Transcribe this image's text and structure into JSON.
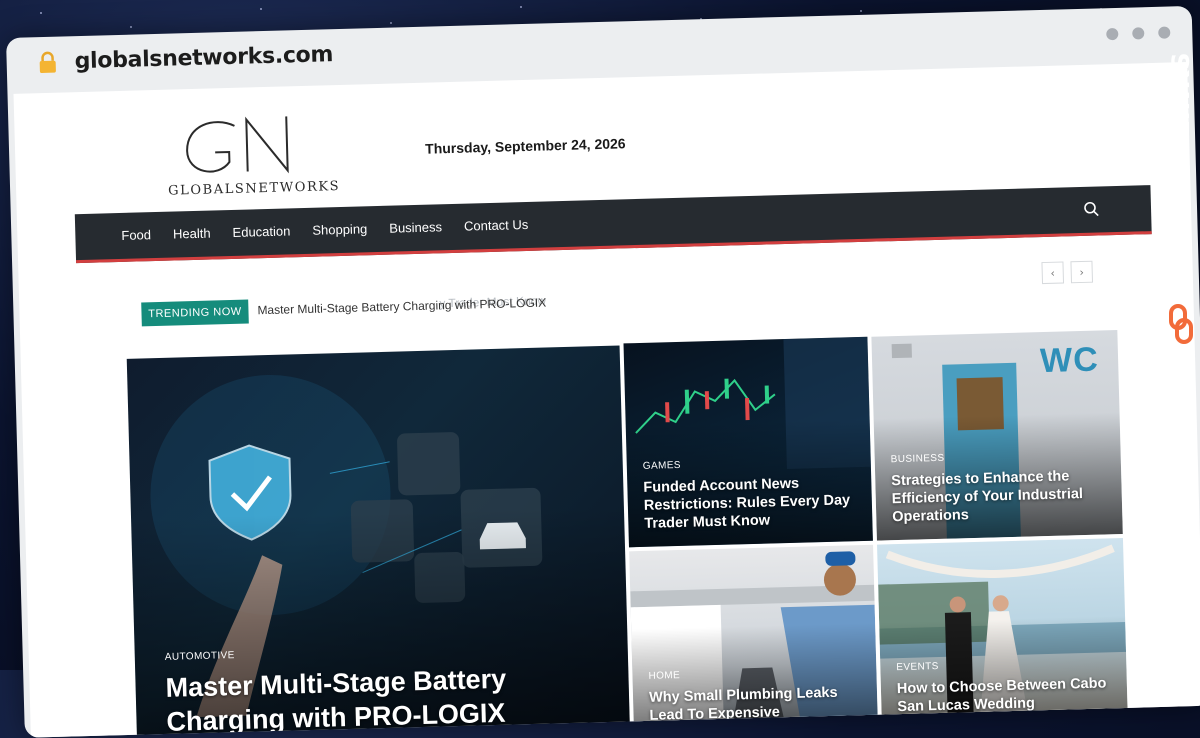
{
  "browser": {
    "url": "globalsnetworks.com"
  },
  "header": {
    "logo_monogram": "GN",
    "logo_name": "GLOBALSNETWORKS",
    "date": "Thursday, September 24, 2026"
  },
  "nav": {
    "items": [
      "Food",
      "Health",
      "Education",
      "Shopping",
      "Business",
      "Contact Us"
    ]
  },
  "trending": {
    "label": "TRENDING NOW",
    "headline": "Master Multi-Stage Battery Charging with PRO-LOGIX",
    "ghost_headline": "y Trader Must Know"
  },
  "featured": {
    "category": "AUTOMOTIVE",
    "title": "Master Multi-Stage Battery Charging with PRO-LOGIX"
  },
  "cards": [
    {
      "category": "GAMES",
      "title": "Funded Account News Restrictions: Rules Every Day Trader Must Know"
    },
    {
      "category": "BUSINESS",
      "title": "Strategies to Enhance the Efficiency of Your Industrial Operations"
    },
    {
      "category": "HOME",
      "title": "Why Small Plumbing Leaks Lead To Expensive"
    },
    {
      "category": "EVENTS",
      "title": "How to Choose Between Cabo San Lucas Wedding"
    }
  ],
  "image_text": {
    "wc_sign": "WC"
  },
  "brand_watermark": "GUESTPOSTLINKS",
  "colors": {
    "nav_bg": "#262b30",
    "nav_accent": "#d23f3f",
    "trending": "#158c7c",
    "brand_orange": "#f26b3a"
  }
}
